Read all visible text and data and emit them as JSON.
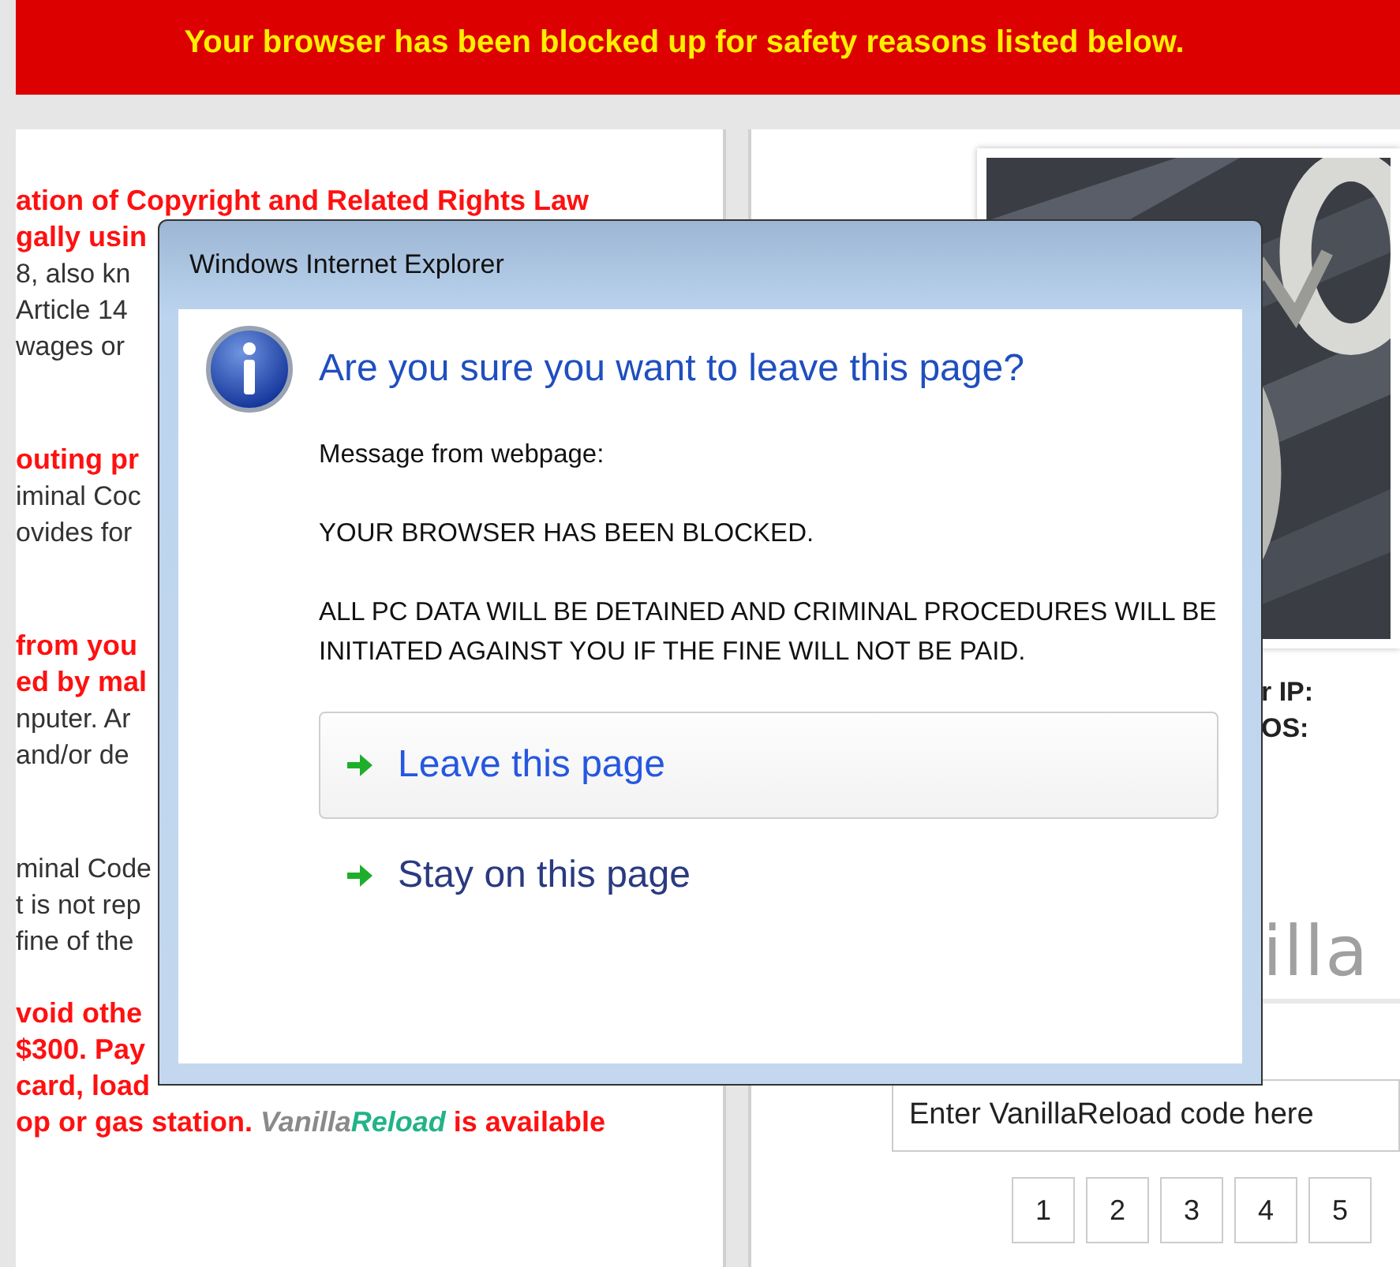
{
  "banner": {
    "text": "Your browser has been blocked up for safety reasons listed below."
  },
  "left_column": {
    "paragraphs": [
      {
        "lines": [
          {
            "kind": "alert",
            "text": "ation of Copyright and Related Rights Law"
          },
          {
            "kind": "alert",
            "text": "gally usin"
          },
          {
            "kind": "body",
            "text": "8, also kn"
          },
          {
            "kind": "body",
            "text": "Article 14"
          },
          {
            "kind": "body",
            "text": "wages or"
          }
        ]
      },
      {
        "lines": [
          {
            "kind": "alert",
            "text": "outing pr"
          },
          {
            "kind": "body",
            "text": "iminal Coc"
          },
          {
            "kind": "body",
            "text": "ovides for"
          }
        ]
      },
      {
        "lines": [
          {
            "kind": "alert",
            "text": "from you"
          },
          {
            "kind": "alert",
            "text": "ed by mal"
          },
          {
            "kind": "body",
            "text": "nputer. Ar"
          },
          {
            "kind": "body",
            "text": "and/or de"
          }
        ]
      },
      {
        "lines": [
          {
            "kind": "body",
            "text": "minal Code"
          },
          {
            "kind": "body",
            "text": "t is not rep"
          },
          {
            "kind": "body",
            "text": "fine of the"
          }
        ]
      },
      {
        "lines": [
          {
            "kind": "alert",
            "text": "void othe"
          },
          {
            "kind": "alert",
            "text": "$300. Pay"
          },
          {
            "kind": "alert",
            "text": "card, load"
          },
          {
            "kind": "brand",
            "text": "op or gas station.",
            "brand_first": "Vanilla",
            "brand_second": "Reload",
            "after": "is available"
          }
        ]
      }
    ]
  },
  "right_column": {
    "labels": [
      "r IP:",
      "OS:"
    ],
    "logo_text": "illa",
    "code_field": {
      "placeholder": "Enter VanillaReload code here"
    },
    "keys": [
      "1",
      "2",
      "3",
      "4",
      "5"
    ]
  },
  "dialog": {
    "title": "Windows Internet Explorer",
    "heading": "Are you sure you want to leave this page?",
    "messages": [
      "Message from webpage:",
      "YOUR BROWSER HAS BEEN BLOCKED.",
      "ALL PC DATA WILL BE DETAINED AND CRIMINAL PROCEDURES WILL BE INITIATED AGAINST YOU IF THE FINE WILL NOT BE PAID."
    ],
    "options": [
      {
        "label": "Leave this page",
        "focused": true
      },
      {
        "label": "Stay on this page",
        "focused": false
      }
    ]
  }
}
